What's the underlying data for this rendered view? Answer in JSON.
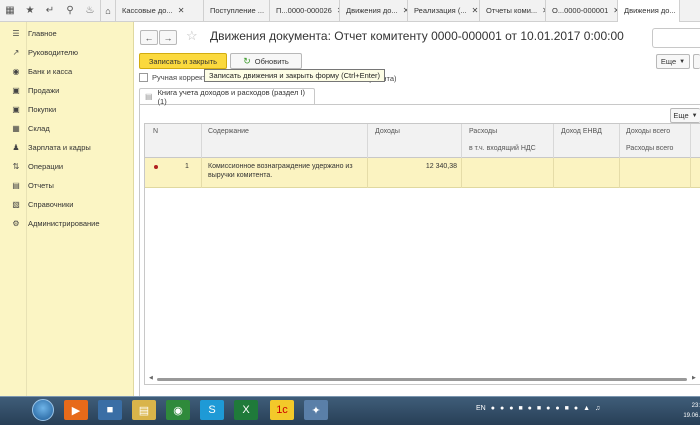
{
  "topbar": {
    "tabs": [
      {
        "label": "Кассовые до..."
      },
      {
        "label": "Поступление ..."
      },
      {
        "label": "П...0000-000026"
      },
      {
        "label": "Движения до..."
      },
      {
        "label": "Реализация (..."
      },
      {
        "label": "Отчеты коми..."
      },
      {
        "label": "О...0000-000001"
      },
      {
        "label": "Движения до..."
      }
    ]
  },
  "sidebar": {
    "items": [
      {
        "label": "Главное",
        "icon": "list-icon"
      },
      {
        "label": "Руководителю",
        "icon": "trend-icon"
      },
      {
        "label": "Банк и касса",
        "icon": "bank-icon"
      },
      {
        "label": "Продажи",
        "icon": "cart-icon"
      },
      {
        "label": "Покупки",
        "icon": "cart-icon"
      },
      {
        "label": "Склад",
        "icon": "warehouse-icon"
      },
      {
        "label": "Зарплата и кадры",
        "icon": "people-icon"
      },
      {
        "label": "Операции",
        "icon": "operations-icon"
      },
      {
        "label": "Отчеты",
        "icon": "chart-icon"
      },
      {
        "label": "Справочники",
        "icon": "book-icon"
      },
      {
        "label": "Администрирование",
        "icon": "gear-icon"
      }
    ]
  },
  "header": {
    "title": "Движения документа: Отчет комитенту 0000-000001 от 10.01.2017 0:00:00"
  },
  "toolbar": {
    "save_label": "Записать и закрыть",
    "refresh_label": "Обновить",
    "more_label": "Еще",
    "manual_label": "Ручная корректи",
    "manual_suffix": "кумента)",
    "tooltip": "Записать движения и закрыть форму (Ctrl+Enter)"
  },
  "subtab": {
    "label": "Книга учета доходов и расходов (раздел I) (1)",
    "more_label": "Еще"
  },
  "grid": {
    "headers": {
      "n": "N",
      "content": "Содержание",
      "income": "Доходы",
      "expenses": "Расходы",
      "expenses_vat": "в т.ч. входящий НДС",
      "envd": "Доход ЕНВД",
      "income_total": "Доходы всего",
      "expenses_total": "Расходы всего"
    },
    "rows": [
      {
        "n": "1",
        "content_line1": "Комиссионное вознаграждение удержано из",
        "content_line2": "выручки комитента.",
        "income": "12 340,38"
      }
    ]
  },
  "taskbar": {
    "language": "EN",
    "clock_time": "23:",
    "clock_date": "19.06."
  },
  "colors": {
    "sidebar_bg": "#fbf5c4",
    "save_button": "#fbd93e",
    "selected_row": "#fbf3c1",
    "taskbar": "#2c4560"
  }
}
